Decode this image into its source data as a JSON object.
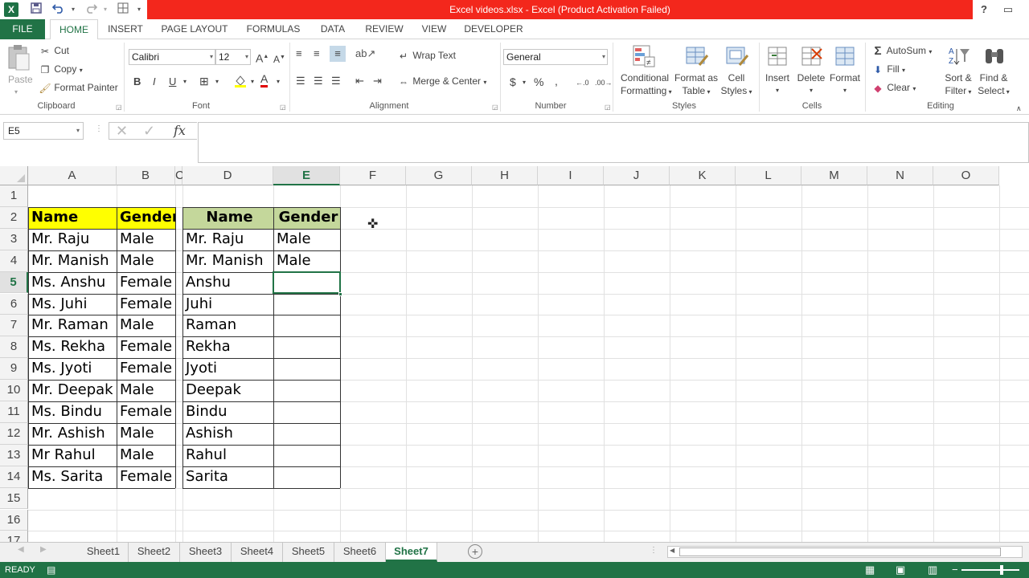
{
  "titlebar": {
    "title": "Excel videos.xlsx -  Excel (Product Activation Failed)",
    "help": "?",
    "restore": "▭"
  },
  "ribbon_tabs": [
    "FILE",
    "HOME",
    "INSERT",
    "PAGE LAYOUT",
    "FORMULAS",
    "DATA",
    "REVIEW",
    "VIEW",
    "DEVELOPER"
  ],
  "active_tab": "HOME",
  "clipboard": {
    "paste": "Paste",
    "cut": "Cut",
    "copy": "Copy",
    "format_painter": "Format Painter",
    "label": "Clipboard"
  },
  "font": {
    "family": "Calibri",
    "size": "12",
    "grow": "A",
    "shrink": "A",
    "bold": "B",
    "italic": "I",
    "underline": "U",
    "font_color_glyph": "A",
    "label": "Font"
  },
  "alignment": {
    "wrap_text": "Wrap Text",
    "merge_center": "Merge & Center",
    "label": "Alignment"
  },
  "number": {
    "format": "General",
    "currency": "$",
    "percent": "%",
    "comma": ",",
    "label": "Number"
  },
  "styles": {
    "conditional_1": "Conditional",
    "conditional_2": "Formatting",
    "format_as_1": "Format as",
    "format_as_2": "Table",
    "cell_styles_1": "Cell",
    "cell_styles_2": "Styles",
    "label": "Styles"
  },
  "cells": {
    "insert": "Insert",
    "delete": "Delete",
    "format": "Format",
    "label": "Cells"
  },
  "editing": {
    "autosum": "AutoSum",
    "fill": "Fill",
    "clear": "Clear",
    "sort_1": "Sort &",
    "sort_2": "Filter",
    "find_1": "Find &",
    "find_2": "Select",
    "label": "Editing"
  },
  "formula_bar": {
    "name_box": "E5",
    "fx": "fx",
    "value": ""
  },
  "columns": [
    "A",
    "B",
    "C",
    "D",
    "E",
    "F",
    "G",
    "H",
    "I",
    "J",
    "K",
    "L",
    "M",
    "N",
    "O"
  ],
  "selected_column": "E",
  "rows": [
    "1",
    "2",
    "3",
    "4",
    "5",
    "6",
    "7",
    "8",
    "9",
    "10",
    "11",
    "12",
    "13",
    "14",
    "15",
    "16",
    "17"
  ],
  "selected_row": "5",
  "table1": {
    "header_name": "Name",
    "header_gender": "Gender",
    "rows": [
      [
        "Mr. Raju",
        "Male"
      ],
      [
        "Mr. Manish",
        "Male"
      ],
      [
        "Ms. Anshu",
        "Female"
      ],
      [
        "Ms. Juhi",
        "Female"
      ],
      [
        "Mr. Raman",
        "Male"
      ],
      [
        "Ms. Rekha",
        "Female"
      ],
      [
        "Ms. Jyoti",
        "Female"
      ],
      [
        "Mr. Deepak",
        "Male"
      ],
      [
        "Ms. Bindu",
        "Female"
      ],
      [
        "Mr. Ashish",
        "Male"
      ],
      [
        "Mr Rahul",
        "Male"
      ],
      [
        "Ms. Sarita",
        "Female"
      ]
    ],
    "header_color": "#ffff00"
  },
  "table2": {
    "header_name": "Name",
    "header_gender": "Gender",
    "rows": [
      [
        "Mr. Raju",
        "Male"
      ],
      [
        "Mr. Manish",
        "Male"
      ],
      [
        "Anshu",
        ""
      ],
      [
        "Juhi",
        ""
      ],
      [
        "Raman",
        ""
      ],
      [
        "Rekha",
        ""
      ],
      [
        "Jyoti",
        ""
      ],
      [
        "Deepak",
        ""
      ],
      [
        "Bindu",
        ""
      ],
      [
        "Ashish",
        ""
      ],
      [
        "Rahul",
        ""
      ],
      [
        "Sarita",
        ""
      ]
    ],
    "header_color": "#c4d79b"
  },
  "sheets": [
    "Sheet1",
    "Sheet2",
    "Sheet3",
    "Sheet4",
    "Sheet5",
    "Sheet6",
    "Sheet7"
  ],
  "active_sheet": "Sheet7",
  "status": {
    "ready": "READY"
  },
  "colors": {
    "excel_green": "#217346",
    "title_red": "#f3271c"
  }
}
